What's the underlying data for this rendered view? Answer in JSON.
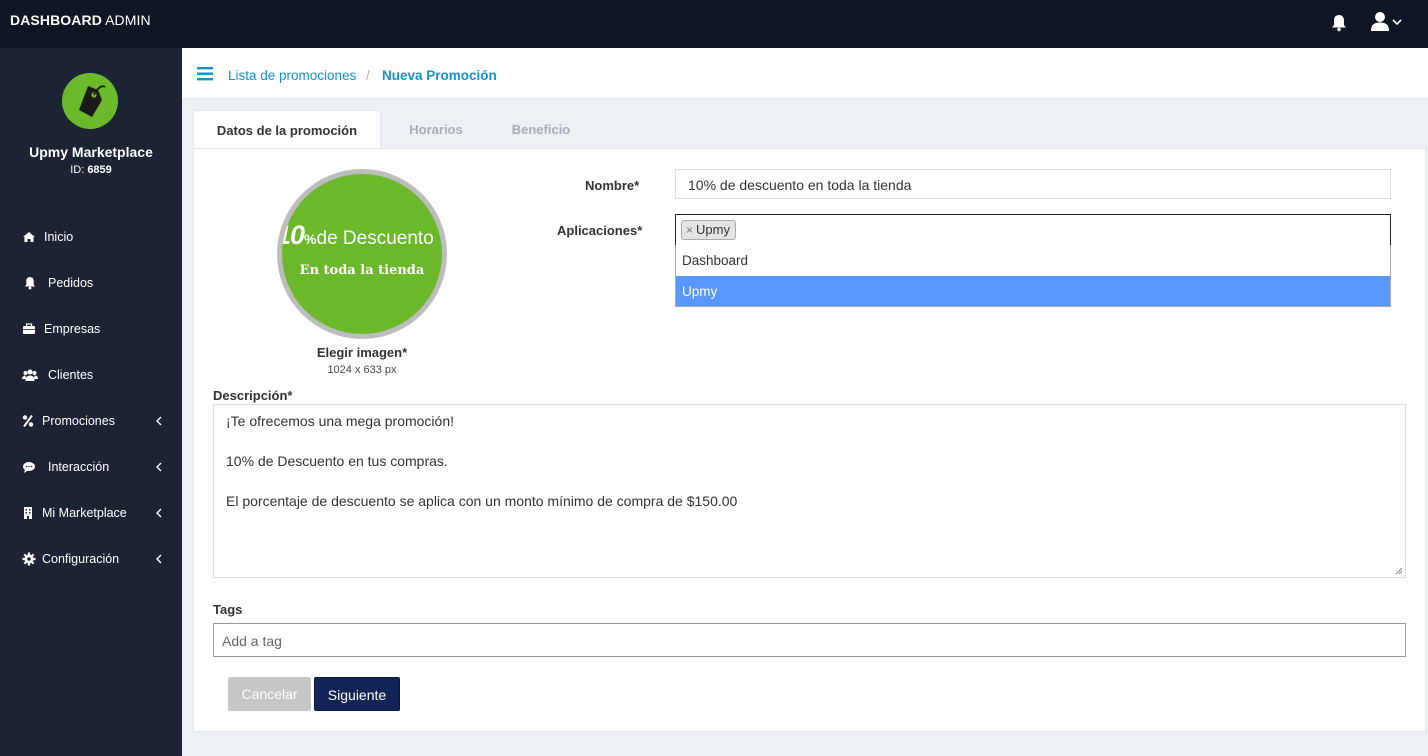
{
  "topbar": {
    "brand_bold": "DASHBOARD",
    "brand_rest": " ADMIN"
  },
  "sidebar": {
    "org_name": "Upmy Marketplace",
    "org_id_label": "ID: ",
    "org_id": "6859",
    "items": [
      {
        "label": "Inicio",
        "icon": "home-icon",
        "has_submenu": false
      },
      {
        "label": "Pedidos",
        "icon": "bell-icon",
        "has_submenu": false
      },
      {
        "label": "Empresas",
        "icon": "briefcase-icon",
        "has_submenu": false
      },
      {
        "label": "Clientes",
        "icon": "users-icon",
        "has_submenu": false
      },
      {
        "label": "Promociones",
        "icon": "percent-icon",
        "has_submenu": true
      },
      {
        "label": "Interacción",
        "icon": "comment-icon",
        "has_submenu": true
      },
      {
        "label": "Mi Marketplace",
        "icon": "building-icon",
        "has_submenu": true
      },
      {
        "label": "Configuración",
        "icon": "cog-icon",
        "has_submenu": true
      }
    ]
  },
  "breadcrumb": {
    "parent": "Lista de promociones",
    "separator": "/",
    "current": "Nueva Promoción"
  },
  "tabs": [
    {
      "label": "Datos de la promoción",
      "active": true
    },
    {
      "label": "Horarios",
      "active": false
    },
    {
      "label": "Beneficio",
      "active": false
    }
  ],
  "form": {
    "image": {
      "headline_big": "10",
      "headline_pct": "%",
      "headline_rest": "de Descuento",
      "subline": "En toda la tienda",
      "label": "Elegir imagen*",
      "size_hint": "1024 x 633 px"
    },
    "name": {
      "label": "Nombre*",
      "value": "10% de descuento en toda la tienda"
    },
    "applications": {
      "label": "Aplicaciones*",
      "selected_chip": "Upmy",
      "chip_remove": "×",
      "options": [
        {
          "label": "Dashboard",
          "highlighted": false
        },
        {
          "label": "Upmy",
          "highlighted": true
        }
      ]
    },
    "description": {
      "label": "Descripción*",
      "lines": [
        "¡Te ofrecemos una mega promoción!",
        "10% de Descuento en tus compras.",
        "El porcentaje de descuento se aplica con un monto mínimo de compra de $150.00"
      ]
    },
    "tags": {
      "label": "Tags",
      "placeholder": "Add a tag"
    },
    "buttons": {
      "cancel": "Cancelar",
      "next": "Siguiente"
    }
  },
  "colors": {
    "topbar_bg": "#0f1724",
    "sidebar_bg": "#1c2434",
    "accent_link": "#1891c9",
    "brand_green": "#6bba2b",
    "option_highlight": "#5897fb",
    "primary_button": "#122456"
  }
}
